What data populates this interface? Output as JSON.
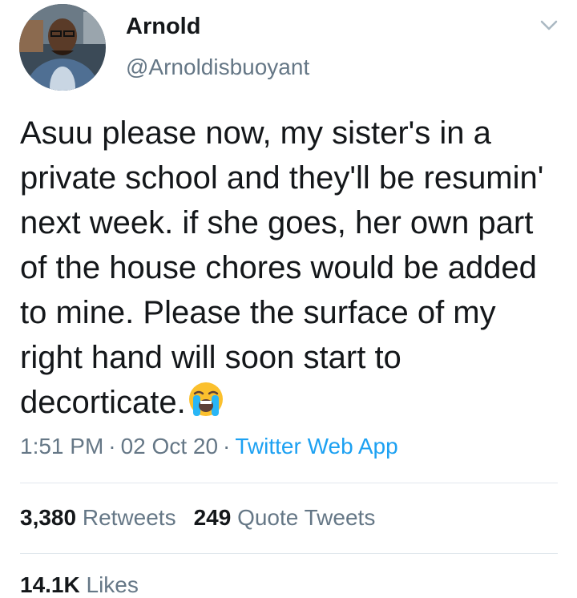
{
  "author": {
    "name": "Arnold",
    "handle": "@Arnoldisbuoyant"
  },
  "tweet": {
    "text": "Asuu please now, my sister's in a private school and they'll be resumin' next week. if she goes, her own part of the house chores would be added to mine. Please the surface of my right hand will soon start to decorticate.",
    "emoji": "loudly-crying-face"
  },
  "meta": {
    "time": "1:51 PM",
    "date": "02 Oct 20",
    "separator": "·",
    "source": "Twitter Web App"
  },
  "stats": {
    "retweets_count": "3,380",
    "retweets_label": "Retweets",
    "quotes_count": "249",
    "quotes_label": "Quote Tweets",
    "likes_count": "14.1K",
    "likes_label": "Likes"
  },
  "colors": {
    "text": "#14171a",
    "secondary": "#657786",
    "link": "#1da1f2",
    "divider": "#e1e8ed"
  }
}
